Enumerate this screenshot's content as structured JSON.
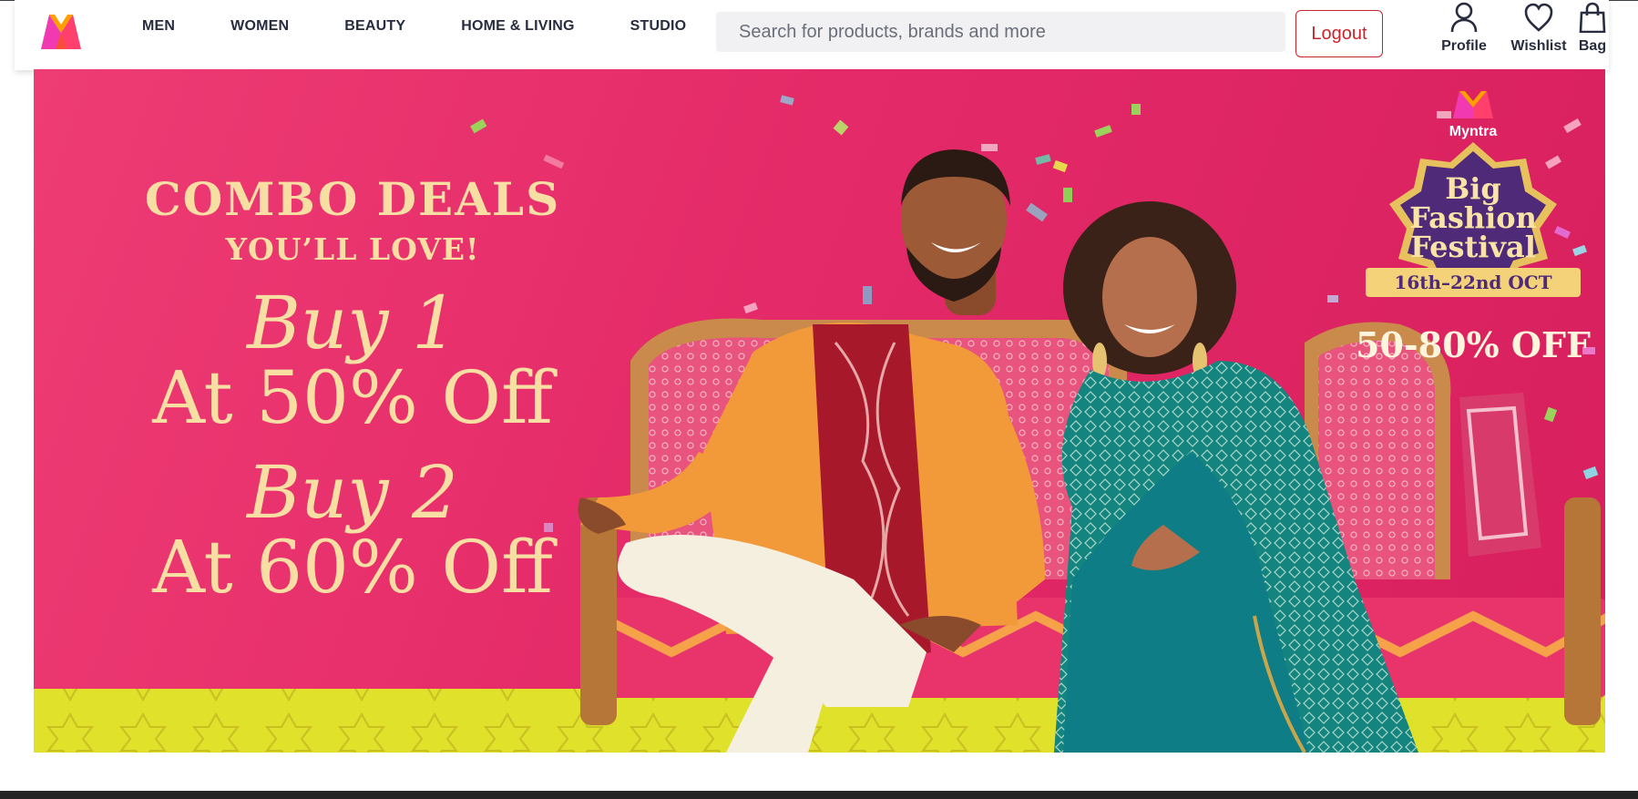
{
  "nav": {
    "logo_alt": "Myntra",
    "menu": [
      {
        "label": "MEN"
      },
      {
        "label": "WOMEN"
      },
      {
        "label": "BEAUTY"
      },
      {
        "label": "HOME & LIVING"
      },
      {
        "label": "STUDIO"
      }
    ],
    "search_placeholder": "Search for products, brands and more",
    "logout_label": "Logout",
    "actions": {
      "profile": {
        "label": "Profile",
        "icon": "user-icon"
      },
      "wishlist": {
        "label": "Wishlist",
        "icon": "heart-icon"
      },
      "bag": {
        "label": "Bag",
        "icon": "bag-icon"
      }
    }
  },
  "banner": {
    "headline": "COMBO DEALS",
    "subheadline": "YOU’LL LOVE!",
    "offers": [
      {
        "buy": "Buy 1",
        "discount": "At 50% Off"
      },
      {
        "buy": "Buy 2",
        "discount": "At 60% Off"
      }
    ],
    "brand": "Myntra",
    "festival_title": [
      "Big",
      "Fashion",
      "Festival"
    ],
    "festival_dates": "16th–22nd OCT",
    "festival_offer": "50-80% OFF"
  },
  "colors": {
    "brand_primary": "#ff3f6c",
    "banner_pink": "#e42a68",
    "text_gold": "#f7dfa3",
    "logout_red": "#c8242c",
    "badge_purple": "#4e2a78"
  }
}
